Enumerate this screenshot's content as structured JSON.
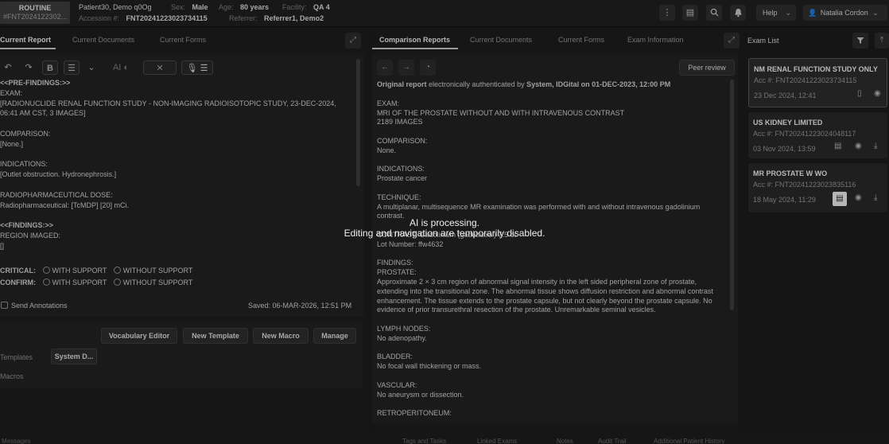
{
  "header": {
    "priority": "ROUTINE",
    "priority_id": "#FNT2024122302...",
    "patient_name": "Patient30, Demo q0Og",
    "sex_label": "Sex:",
    "sex": "Male",
    "age_label": "Age:",
    "age": "80 years",
    "facility_label": "Facility:",
    "facility": "QA 4",
    "accession_label": "Accession #:",
    "accession": "FNT20241223023734115",
    "referrer_label": "Referrer:",
    "referrer": "Referrer1, Demo2",
    "help_label": "Help",
    "user_name": "Natalia Cordon"
  },
  "left_panel": {
    "tabs": [
      "Current Report",
      "Current Documents",
      "Current Forms"
    ],
    "toolbar": {
      "ai_label": "AI"
    },
    "report_lines": [
      "<<PRE-FINDINGS:>>",
      "EXAM:",
      "[RADIONUCLIDE RENAL FUNCTION STUDY - NON-IMAGING RADIOISOTOPIC STUDY, 23-DEC-2024,",
      "06:41 AM CST, 3 IMAGES]",
      "",
      "COMPARISON:",
      "[None.]",
      "",
      "INDICATIONS:",
      "[Outlet obstruction. Hydronephrosis.]",
      "",
      "RADIOPHARMACEUTICAL DOSE:",
      "Radiopharmaceutical: [TcMDP] [20] mCi.",
      "",
      "<<FINDINGS:>>",
      "REGION IMAGED:",
      "[]"
    ],
    "critical_label": "CRITICAL:",
    "confirm_label": "CONFIRM:",
    "with_support": "WITH SUPPORT",
    "without_support": "WITHOUT SUPPORT",
    "send_annotations": "Send Annotations",
    "saved_status": "Saved: 06-MAR-2026, 12:51 PM",
    "buttons": {
      "vocabulary_editor": "Vocabulary Editor",
      "new_template": "New Template",
      "new_macro": "New Macro",
      "manage": "Manage"
    },
    "templates_label": "Templates",
    "template_chip": "System D...",
    "macros_label": "Macros"
  },
  "middle_panel": {
    "tabs": [
      "Comparison Reports",
      "Current Documents",
      "Current Forms",
      "Exam Information"
    ],
    "peer_review": "Peer review",
    "original_prefix": "Original report",
    "original_mid": "electronically authenticated by",
    "original_author": "System, IDGital on 01-DEC-2023, 12:00 PM",
    "report": [
      "EXAM:",
      "MRI OF THE PROSTATE WITHOUT AND WITH INTRAVENOUS CONTRAST",
      "2189 IMAGES",
      "",
      "COMPARISON:",
      "None.",
      "",
      "INDICATIONS:",
      "Prostate cancer",
      "",
      "TECHNIQUE:",
      "A multiplanar, multisequence MR examination was performed with and without intravenous gadolinium contrast.",
      "",
      "CONTRAST: Gadolinium (gadobutrol) 7.5 cc",
      "Lot Number: ffw4632",
      "",
      "FINDINGS:",
      "PROSTATE:",
      "Approximate 2 × 3 cm region of abnormal signal intensity in the left sided peripheral zone of prostate, extending into the transitional zone. The abnormal tissue shows diffusion restriction and abnormal contrast enhancement. The tissue extends to the prostate capsule, but not clearly beyond the prostate capsule. No evidence of prior transurethral resection of the prostate. Unremarkable seminal vesicles.",
      "",
      "LYMPH NODES:",
      "No adenopathy.",
      "",
      "BLADDER:",
      "No focal wall thickening or mass.",
      "",
      "VASCULAR:",
      "No aneurysm or dissection.",
      "",
      "RETROPERITONEUM:"
    ]
  },
  "exam_list": {
    "title": "Exam List",
    "items": [
      {
        "title": "NM RENAL FUNCTION STUDY ONLY",
        "acc": "Acc #: FNT20241223023734115",
        "date": "23 Dec 2024, 12:41"
      },
      {
        "title": "US KIDNEY LIMITED",
        "acc": "Acc #: FNT20241223024048117",
        "date": "03 Nov 2024, 13:59"
      },
      {
        "title": "MR PROSTATE W WO",
        "acc": "Acc #: FNT20241223023835116",
        "date": "18 May 2024, 11:29"
      }
    ]
  },
  "overlay": {
    "line1": "AI is processing.",
    "line2": "Editing and navigation are temporarily disabled."
  },
  "footer": {
    "items": [
      "Messages",
      "Tags and Tasks",
      "Linked Exams",
      "Notes",
      "Audit Trail",
      "Additional Patient History"
    ]
  }
}
